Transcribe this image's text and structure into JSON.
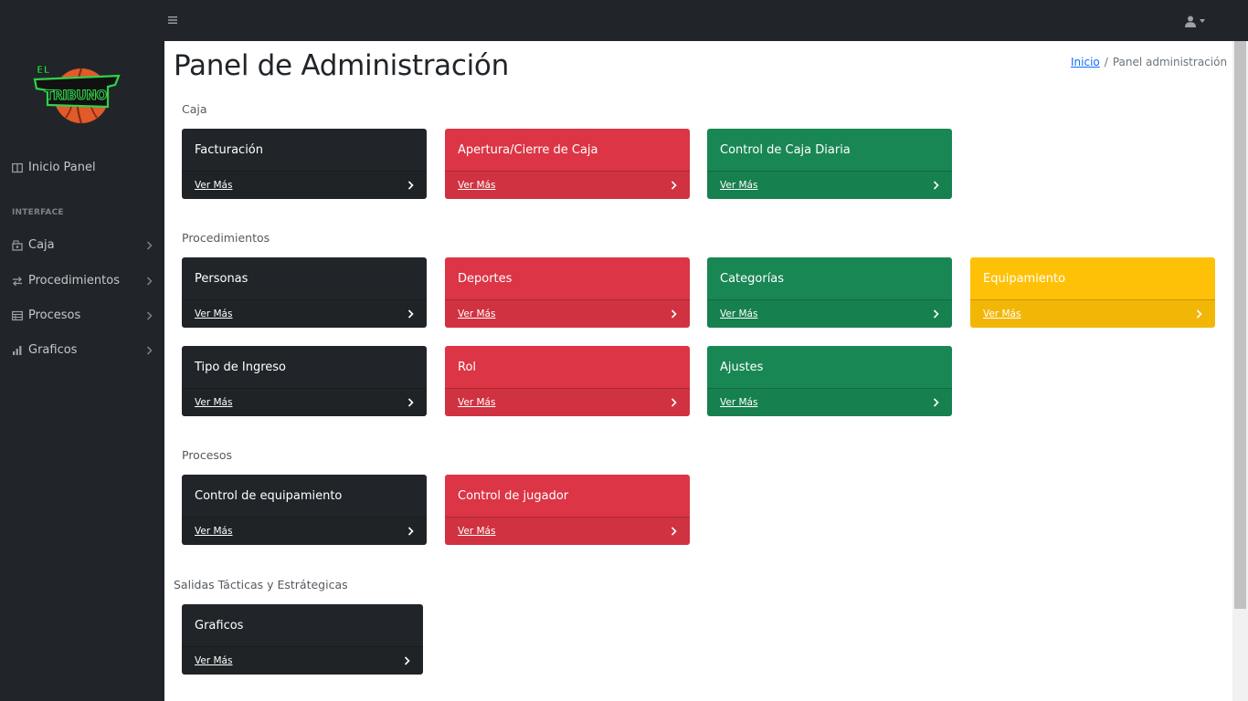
{
  "header": {
    "menu_icon": "hamburger-icon",
    "user_icon": "user-icon"
  },
  "logo": {
    "text_top": "EL",
    "text_main": "TRIBUNO"
  },
  "sidebar": {
    "items": [
      {
        "label": "Inicio Panel",
        "icon": "columns-icon"
      },
      {
        "label": "Caja",
        "icon": "cash-register-icon"
      },
      {
        "label": "Procedimientos",
        "icon": "exchange-icon"
      },
      {
        "label": "Procesos",
        "icon": "table-icon"
      },
      {
        "label": "Graficos",
        "icon": "bar-chart-icon"
      }
    ],
    "heading": "INTERFACE"
  },
  "page": {
    "title": "Panel de Administración",
    "breadcrumb": {
      "home": "Inicio",
      "current": "Panel administración"
    }
  },
  "sections": [
    {
      "title": "Caja",
      "cards": [
        {
          "title": "Facturación",
          "link": "Ver Más",
          "color": "#212529"
        },
        {
          "title": "Apertura/Cierre de Caja",
          "link": "Ver Más",
          "color": "#dc3545"
        },
        {
          "title": "Control de Caja Diaria",
          "link": "Ver Más",
          "color": "#198754"
        }
      ]
    },
    {
      "title": "Procedimientos",
      "cards": [
        {
          "title": "Personas",
          "link": "Ver Más",
          "color": "#212529"
        },
        {
          "title": "Deportes",
          "link": "Ver Más",
          "color": "#dc3545"
        },
        {
          "title": "Categorías",
          "link": "Ver Más",
          "color": "#198754"
        },
        {
          "title": "Equipamiento",
          "link": "Ver Más",
          "color": "#ffc107"
        },
        {
          "title": "Tipo de Ingreso",
          "link": "Ver Más",
          "color": "#212529"
        },
        {
          "title": "Rol",
          "link": "Ver Más",
          "color": "#dc3545"
        },
        {
          "title": "Ajustes",
          "link": "Ver Más",
          "color": "#198754"
        }
      ]
    },
    {
      "title": "Procesos",
      "cards": [
        {
          "title": "Control de equipamiento",
          "link": "Ver Más",
          "color": "#212529"
        },
        {
          "title": "Control de jugador",
          "link": "Ver Más",
          "color": "#dc3545"
        }
      ]
    },
    {
      "title": "Salidas Tácticas y Estrátegicas",
      "cards": [
        {
          "title": "Graficos",
          "link": "Ver Más",
          "color": "#212529"
        }
      ]
    }
  ]
}
